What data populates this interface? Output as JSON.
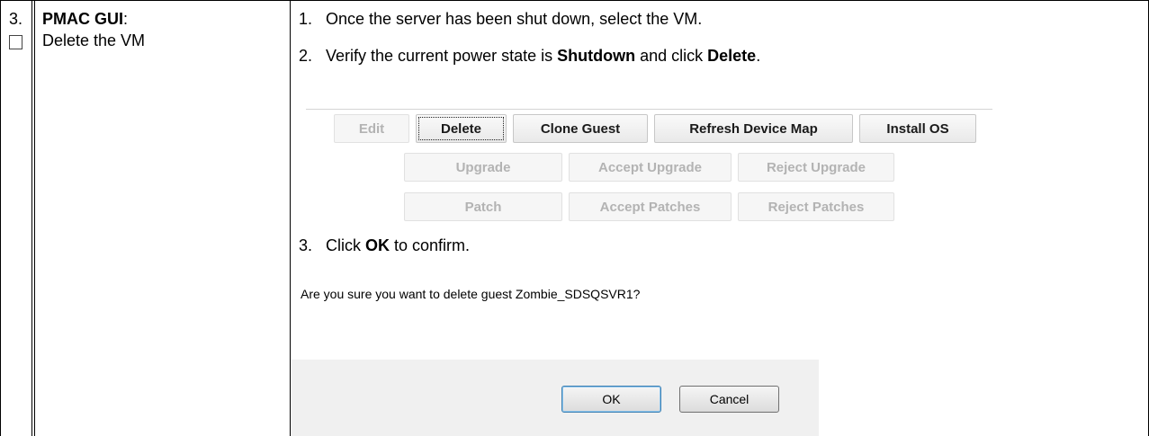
{
  "step": {
    "number": "3.",
    "title": "PMAC GUI",
    "title_suffix": ":",
    "description": "Delete the VM"
  },
  "instructions": [
    {
      "num": "1.",
      "text": "Once the server has been shut down, select the VM."
    },
    {
      "num": "2.",
      "pre": "Verify the current power state is ",
      "bold1": "Shutdown",
      "mid": " and click ",
      "bold2": "Delete",
      "post": "."
    },
    {
      "num": "3.",
      "pre": "Click ",
      "bold1": "OK",
      "post": " to confirm."
    }
  ],
  "toolbar": {
    "edit": "Edit",
    "delete": "Delete",
    "clone_guest": "Clone Guest",
    "refresh_device_map": "Refresh Device Map",
    "install_os": "Install OS",
    "upgrade": "Upgrade",
    "accept_upgrade": "Accept Upgrade",
    "reject_upgrade": "Reject Upgrade",
    "patch": "Patch",
    "accept_patches": "Accept Patches",
    "reject_patches": "Reject Patches"
  },
  "dialog": {
    "message": "Are you sure you want to delete guest Zombie_SDSQSVR1?",
    "ok_label": "OK",
    "cancel_label": "Cancel"
  },
  "colors": {
    "disabled_text": "#b3b3b3",
    "dialog_footer": "#f0f0f0"
  }
}
